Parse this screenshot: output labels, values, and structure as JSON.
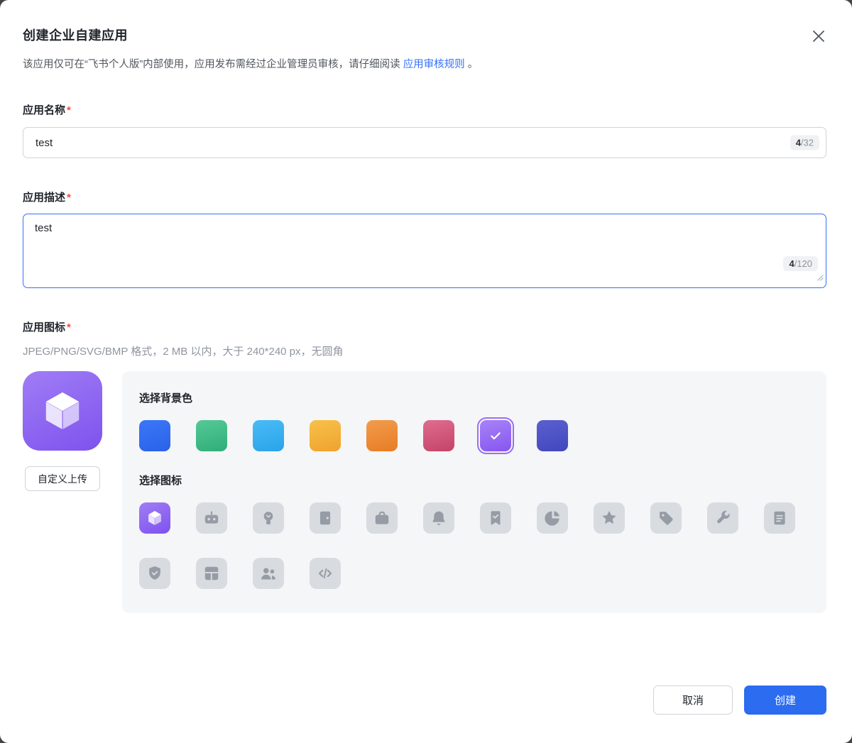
{
  "dialog": {
    "title": "创建企业自建应用",
    "subtitle_prefix": "该应用仅可在“飞书个人版”内部使用，应用发布需经过企业管理员审核，请仔细阅读 ",
    "subtitle_link": "应用审核规则",
    "subtitle_suffix": " 。"
  },
  "form": {
    "name": {
      "label": "应用名称",
      "required_mark": "*",
      "value": "test",
      "count": "4",
      "max": "/32"
    },
    "description": {
      "label": "应用描述",
      "required_mark": "*",
      "value": "test",
      "count": "4",
      "max": "/120"
    },
    "icon": {
      "label": "应用图标",
      "required_mark": "*",
      "hint": "JPEG/PNG/SVG/BMP 格式，2 MB 以内，大于 240*240 px，无圆角",
      "upload_button": "自定义上传",
      "bg_section_title": "选择背景色",
      "icon_section_title": "选择图标",
      "selected_bg": "purple",
      "selected_icon": "cube",
      "colors": [
        {
          "name": "blue",
          "from": "#3a77f7",
          "to": "#2a62e8",
          "selected": false
        },
        {
          "name": "green",
          "from": "#55c997",
          "to": "#2fae78",
          "selected": false
        },
        {
          "name": "sky",
          "from": "#49bcf6",
          "to": "#2aa3ea",
          "selected": false
        },
        {
          "name": "amber",
          "from": "#f7c14a",
          "to": "#efa32c",
          "selected": false
        },
        {
          "name": "orange",
          "from": "#f29c4d",
          "to": "#e87c24",
          "selected": false
        },
        {
          "name": "rose",
          "from": "#df6d8f",
          "to": "#c44367",
          "selected": false
        },
        {
          "name": "purple",
          "from": "#a783f8",
          "to": "#8756ef",
          "selected": true
        },
        {
          "name": "indigo",
          "from": "#5a60cf",
          "to": "#4247bd",
          "selected": false
        }
      ],
      "icons": [
        {
          "name": "cube",
          "selected": true
        },
        {
          "name": "robot",
          "selected": false
        },
        {
          "name": "bulb",
          "selected": false
        },
        {
          "name": "door",
          "selected": false
        },
        {
          "name": "briefcase",
          "selected": false
        },
        {
          "name": "bell",
          "selected": false
        },
        {
          "name": "bookmark",
          "selected": false
        },
        {
          "name": "pie",
          "selected": false
        },
        {
          "name": "star",
          "selected": false
        },
        {
          "name": "tag",
          "selected": false
        },
        {
          "name": "wrench",
          "selected": false
        },
        {
          "name": "doc",
          "selected": false
        },
        {
          "name": "shield",
          "selected": false
        },
        {
          "name": "layout",
          "selected": false
        },
        {
          "name": "users",
          "selected": false
        },
        {
          "name": "code",
          "selected": false
        }
      ]
    }
  },
  "footer": {
    "cancel": "取消",
    "create": "创建"
  }
}
